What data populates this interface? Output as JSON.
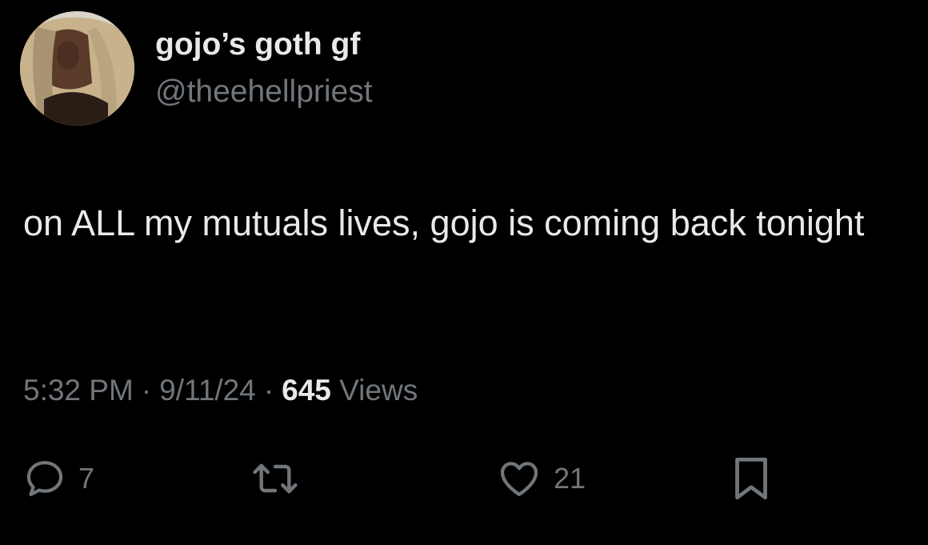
{
  "author": {
    "display_name": "gojo’s goth gf",
    "handle": "@theehellpriest",
    "avatar_icon": "profile-photo"
  },
  "tweet": {
    "text": "on ALL my mutuals lives, gojo is coming back tonight"
  },
  "meta": {
    "time": "5:32 PM",
    "separator": "·",
    "date": "9/11/24",
    "views_count": "645",
    "views_label": "Views"
  },
  "actions": {
    "reply": {
      "icon": "reply-icon",
      "count": "7"
    },
    "retweet": {
      "icon": "retweet-icon"
    },
    "like": {
      "icon": "heart-icon",
      "count": "21"
    },
    "bookmark": {
      "icon": "bookmark-icon"
    }
  },
  "colors": {
    "background": "#000000",
    "primary_text": "#e7e9ea",
    "secondary_text": "#71767b"
  }
}
